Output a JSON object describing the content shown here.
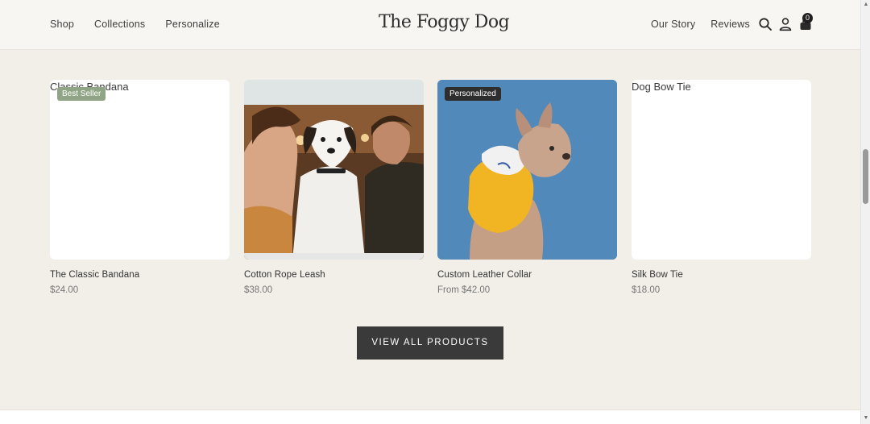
{
  "header": {
    "logo": "The Foggy Dog",
    "nav_left": [
      "Shop",
      "Collections",
      "Personalize"
    ],
    "nav_right": [
      "Our Story",
      "Reviews"
    ],
    "cart_count": "0"
  },
  "products": [
    {
      "name": "The Classic Bandana",
      "price": "$24.00",
      "alt": "Classic Bandana",
      "badge": "Best Seller"
    },
    {
      "name": "Cotton Rope Leash",
      "price": "$38.00"
    },
    {
      "name": "Custom Leather Collar",
      "price": "From $42.00",
      "badge": "Personalized"
    },
    {
      "name": "Silk Bow Tie",
      "price": "$18.00",
      "alt": "Dog Bow Tie"
    }
  ],
  "cta": {
    "label": "VIEW ALL PRODUCTS"
  },
  "icons": {
    "search": "search-icon",
    "account": "user-icon",
    "cart": "bag-icon"
  }
}
